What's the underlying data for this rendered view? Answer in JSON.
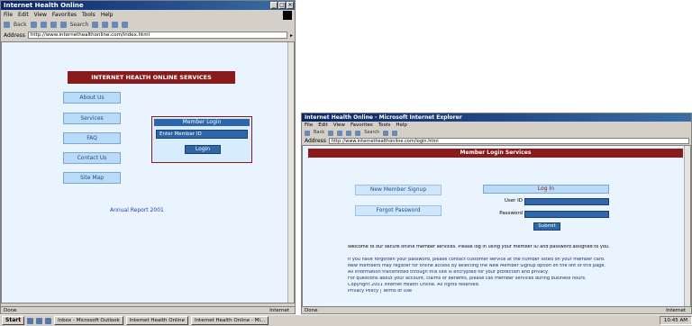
{
  "left_window": {
    "title": "Internet Health Online",
    "menu": [
      "File",
      "Edit",
      "View",
      "Favorites",
      "Tools",
      "Help"
    ],
    "toolbar_labels": [
      "Back",
      "Forward",
      "Stop",
      "Refresh",
      "Home",
      "Search",
      "Favorites",
      "History",
      "Mail",
      "Print"
    ],
    "address_label": "Address",
    "address_value": "http://www.internethealthonline.com/index.html",
    "header": "INTERNET HEALTH ONLINE SERVICES",
    "nav": [
      "About Us",
      "Services",
      "FAQ",
      "Contact Us",
      "Site Map"
    ],
    "login": {
      "title": "Member Login",
      "field": "Enter Member ID",
      "button": "Login"
    },
    "footer_link": "Annual Report 2001",
    "status": "Done",
    "status_zone": "Internet"
  },
  "right_window": {
    "title": "Internet Health Online - Microsoft Internet Explorer",
    "menu": [
      "File",
      "Edit",
      "View",
      "Favorites",
      "Tools",
      "Help"
    ],
    "toolbar_labels": [
      "Back",
      "Forward",
      "Stop",
      "Refresh",
      "Home",
      "Search",
      "Favorites",
      "History",
      "Mail",
      "Print"
    ],
    "address_label": "Address",
    "address_value": "http://www.internethealthonline.com/login.html",
    "header": "Member Login Services",
    "nav": [
      "New Member Signup",
      "Forgot Password"
    ],
    "login": {
      "title": "Log In",
      "user_label": "User ID",
      "pass_label": "Password",
      "button": "Submit"
    },
    "body_lines": [
      "Welcome to our secure online member services. Please log in using your member ID and password assigned to you.",
      "",
      "If you have forgotten your password, please contact customer service at the number listed on your member card.",
      "New members may register for online access by selecting the New Member Signup option on the left of this page.",
      "All information transmitted through this site is encrypted for your protection and privacy.",
      "For questions about your account, claims or benefits, please call member services during business hours.",
      "Copyright 2001 Internet Health Online. All rights reserved.",
      "Privacy Policy | Terms of Use"
    ],
    "status": "Done",
    "status_zone": "Internet"
  },
  "taskbar": {
    "start": "Start",
    "items": [
      "Inbox - Microsoft Outlook",
      "Internet Health Online",
      "Internet Health Online - Mi..."
    ],
    "clock": "10:45 AM"
  }
}
